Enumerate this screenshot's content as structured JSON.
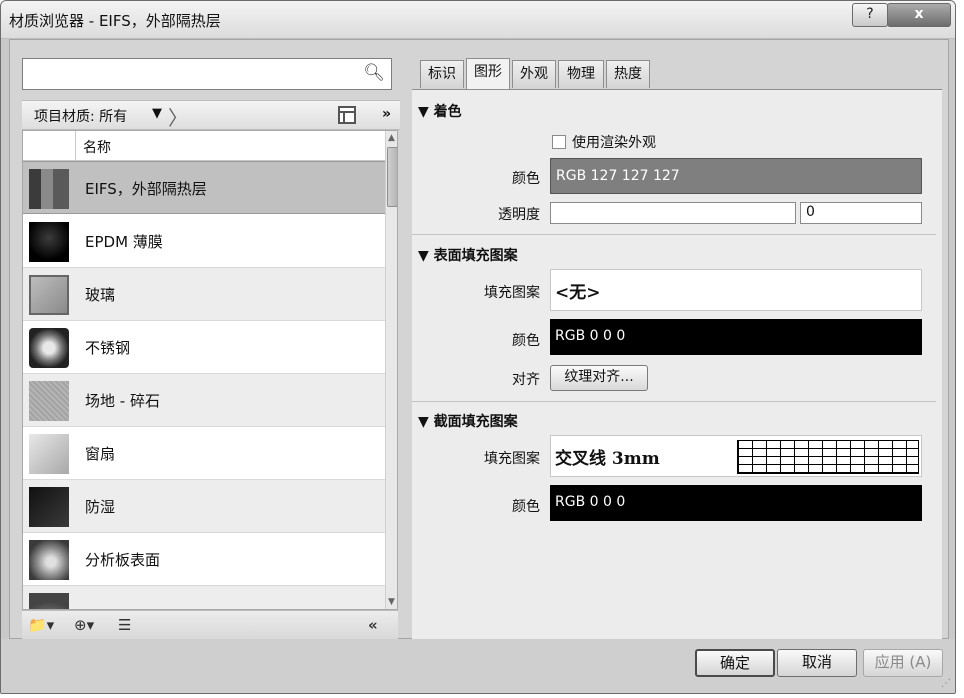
{
  "window": {
    "title": "材质浏览器 - EIFS，外部隔热层",
    "help_label": "?",
    "close_label": "x"
  },
  "left": {
    "search_placeholder": "",
    "crumb": "项目材质: 所有",
    "crumb_dropdown": "▼",
    "expand_label": "»",
    "column_name": "名称",
    "items": [
      {
        "label": "EIFS，外部隔热层",
        "thumb": "eifs"
      },
      {
        "label": "EPDM 薄膜",
        "thumb": "epdm"
      },
      {
        "label": "玻璃",
        "thumb": "glass"
      },
      {
        "label": "不锈钢",
        "thumb": "steel"
      },
      {
        "label": "场地 - 碎石",
        "thumb": "gravel"
      },
      {
        "label": "窗扇",
        "thumb": "door"
      },
      {
        "label": "防湿",
        "thumb": "damp"
      },
      {
        "label": "分析板表面",
        "thumb": "panel"
      }
    ],
    "footer": {
      "new_library_icon": "📁▾",
      "add_icon": "⊕▾",
      "list_icon": "☰",
      "collapse_label": "«"
    }
  },
  "right": {
    "tabs": [
      "标识",
      "图形",
      "外观",
      "物理",
      "热度"
    ],
    "active_tab": "图形",
    "shading": {
      "header": "▼ 着色",
      "use_render_label": "使用渲染外观",
      "color_label": "颜色",
      "color_value": "RGB 127 127 127",
      "transparency_label": "透明度",
      "transparency_value": "0"
    },
    "surface": {
      "header": "▼ 表面填充图案",
      "pattern_label": "填充图案",
      "pattern_value": "<无>",
      "color_label": "颜色",
      "color_value": "RGB 0 0 0",
      "align_label": "对齐",
      "align_button": "纹理对齐..."
    },
    "cut": {
      "header": "▼ 截面填充图案",
      "pattern_label": "填充图案",
      "pattern_value": "交叉线 3mm",
      "color_label": "颜色",
      "color_value": "RGB 0 0 0"
    }
  },
  "footer": {
    "ok": "确定",
    "cancel": "取消",
    "apply": "应用 (A)"
  },
  "colors": {
    "shading_swatch": "#7f7f7f",
    "pattern_swatch": "#000000"
  }
}
